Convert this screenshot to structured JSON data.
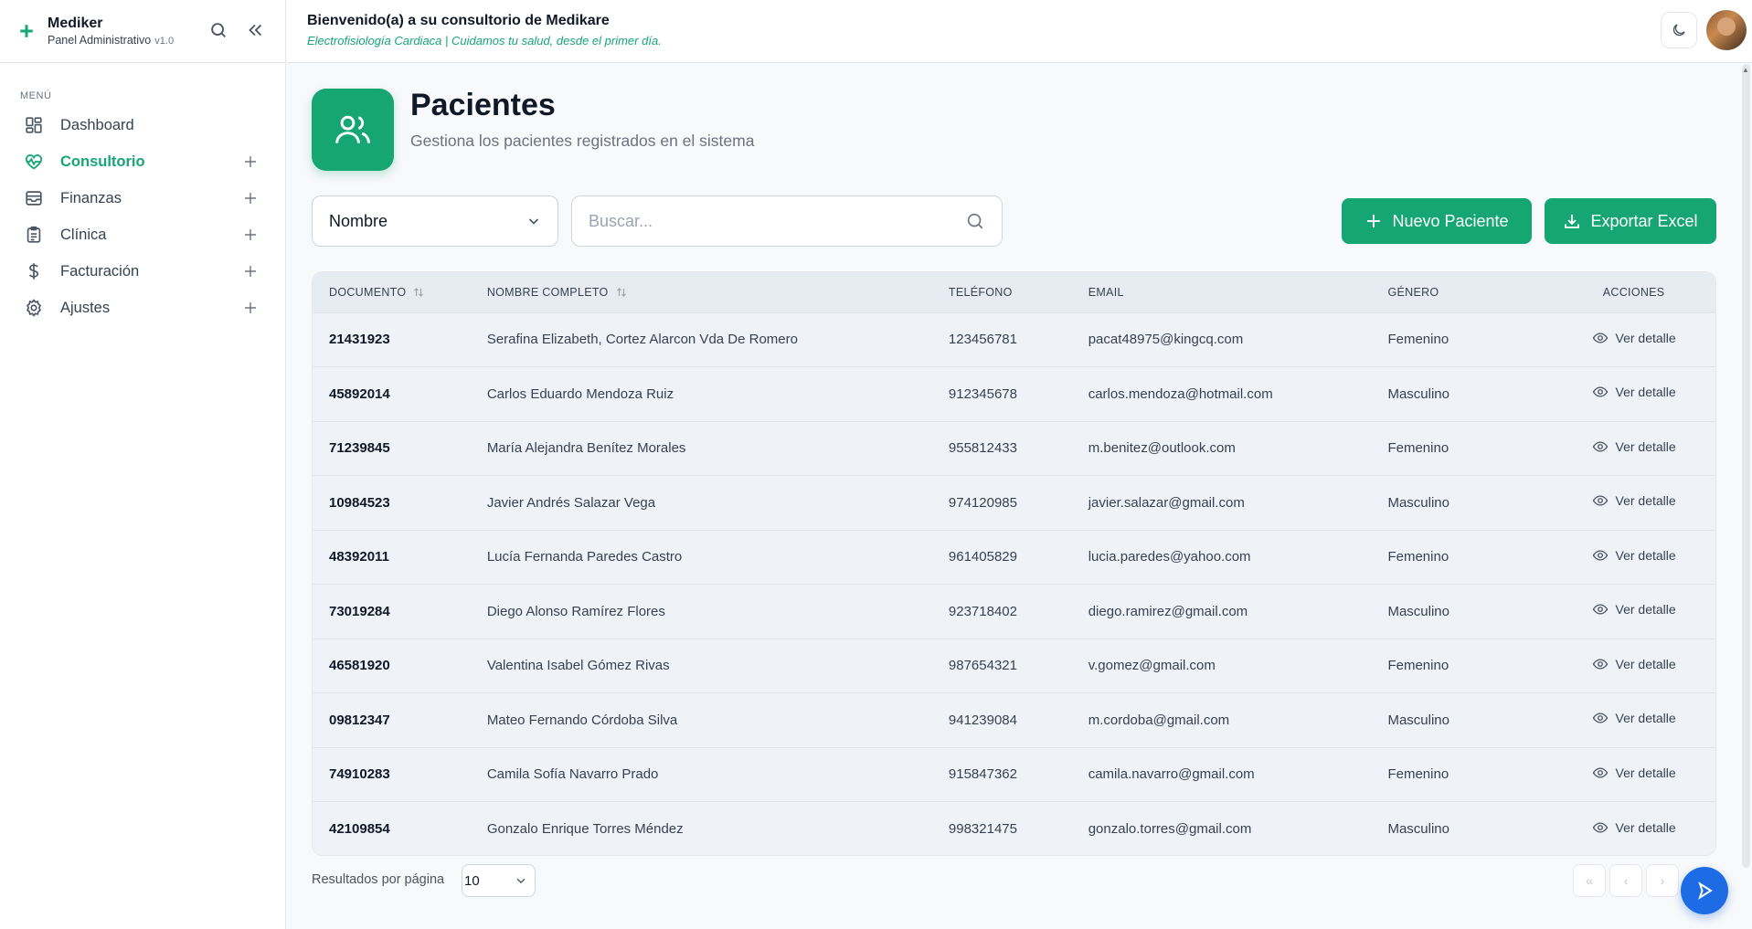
{
  "brand": {
    "name": "Mediker",
    "subtitle": "Panel Administrativo",
    "version": "v1.0"
  },
  "sidebar": {
    "menu_label": "MENÚ",
    "items": [
      {
        "label": "Dashboard",
        "icon": "dashboard-icon"
      },
      {
        "label": "Consultorio",
        "icon": "heart-pulse-icon",
        "active": true
      },
      {
        "label": "Finanzas",
        "icon": "inbox-icon"
      },
      {
        "label": "Clínica",
        "icon": "clipboard-icon"
      },
      {
        "label": "Facturación",
        "icon": "dollar-icon"
      },
      {
        "label": "Ajustes",
        "icon": "gear-icon"
      }
    ]
  },
  "topbar": {
    "welcome": "Bienvenido(a) a su consultorio de Medikare",
    "tagline": "Electrofisiología Cardiaca | Cuidamos tu salud, desde el primer día."
  },
  "page": {
    "title": "Pacientes",
    "subtitle": "Gestiona los pacientes registrados en el sistema"
  },
  "filters": {
    "field": "Nombre",
    "search_placeholder": "Buscar...",
    "search_value": ""
  },
  "buttons": {
    "new_patient": "Nuevo Paciente",
    "export": "Exportar Excel"
  },
  "table": {
    "headers": {
      "documento": "DOCUMENTO",
      "nombre": "NOMBRE COMPLETO",
      "telefono": "TELÉFONO",
      "email": "EMAIL",
      "genero": "GÉNERO",
      "acciones": "ACCIONES"
    },
    "action_label": "Ver detalle",
    "rows": [
      {
        "doc": "21431923",
        "name": "Serafina Elizabeth, Cortez Alarcon Vda De Romero",
        "tel": "123456781",
        "email": "pacat48975@kingcq.com",
        "gender": "Femenino"
      },
      {
        "doc": "45892014",
        "name": "Carlos Eduardo Mendoza Ruiz",
        "tel": "912345678",
        "email": "carlos.mendoza@hotmail.com",
        "gender": "Masculino"
      },
      {
        "doc": "71239845",
        "name": "María Alejandra Benítez Morales",
        "tel": "955812433",
        "email": "m.benitez@outlook.com",
        "gender": "Femenino"
      },
      {
        "doc": "10984523",
        "name": "Javier Andrés Salazar Vega",
        "tel": "974120985",
        "email": "javier.salazar@gmail.com",
        "gender": "Masculino"
      },
      {
        "doc": "48392011",
        "name": "Lucía Fernanda Paredes Castro",
        "tel": "961405829",
        "email": "lucia.paredes@yahoo.com",
        "gender": "Femenino"
      },
      {
        "doc": "73019284",
        "name": "Diego Alonso Ramírez Flores",
        "tel": "923718402",
        "email": "diego.ramirez@gmail.com",
        "gender": "Masculino"
      },
      {
        "doc": "46581920",
        "name": "Valentina Isabel Gómez Rivas",
        "tel": "987654321",
        "email": "v.gomez@gmail.com",
        "gender": "Femenino"
      },
      {
        "doc": "09812347",
        "name": "Mateo Fernando Córdoba Silva",
        "tel": "941239084",
        "email": "m.cordoba@gmail.com",
        "gender": "Masculino"
      },
      {
        "doc": "74910283",
        "name": "Camila Sofía Navarro Prado",
        "tel": "915847362",
        "email": "camila.navarro@gmail.com",
        "gender": "Femenino"
      },
      {
        "doc": "42109854",
        "name": "Gonzalo Enrique Torres Méndez",
        "tel": "998321475",
        "email": "gonzalo.torres@gmail.com",
        "gender": "Masculino"
      }
    ]
  },
  "footer": {
    "per_page_label": "Resultados por página",
    "per_page_value": "10",
    "pager": {
      "first": "«",
      "prev": "‹",
      "next": "›"
    }
  },
  "colors": {
    "accent": "#16a673",
    "fab": "#1d6be5",
    "row_bg": "#eff3f7",
    "header_bg": "#e6ecf2"
  }
}
